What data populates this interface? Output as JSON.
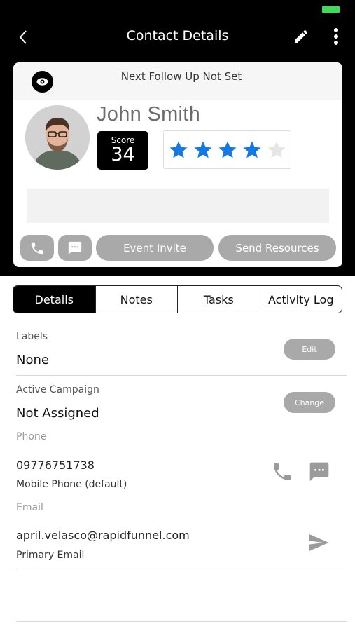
{
  "header": {
    "title": "Contact Details"
  },
  "card": {
    "follow_up": "Next Follow Up Not Set",
    "name": "John Smith",
    "score_label": "Score",
    "score_value": "34",
    "rating": 4,
    "rating_max": 5,
    "actions": {
      "event_invite": "Event Invite",
      "send_resources": "Send Resources"
    }
  },
  "tabs": [
    "Details",
    "Notes",
    "Tasks",
    "Activity Log"
  ],
  "details": {
    "labels": {
      "label": "Labels",
      "value": "None",
      "button": "Edit"
    },
    "campaign": {
      "label": "Active Campaign",
      "value": "Not Assigned",
      "button": "Change"
    },
    "phone": {
      "label": "Phone",
      "value": "09776751738",
      "sub": "Mobile Phone (default)"
    },
    "email": {
      "label": "Email",
      "value": "april.velasco@rapidfunnel.com",
      "sub": "Primary Email"
    }
  },
  "colors": {
    "star_active": "#1479e3",
    "star_inactive": "#e6e6e6",
    "battery": "#3ddc5a",
    "button_gray": "#a9a9a9"
  },
  "icons": [
    "back-icon",
    "pencil-icon",
    "more-vertical-icon",
    "eye-icon",
    "phone-icon",
    "message-icon",
    "send-icon"
  ]
}
